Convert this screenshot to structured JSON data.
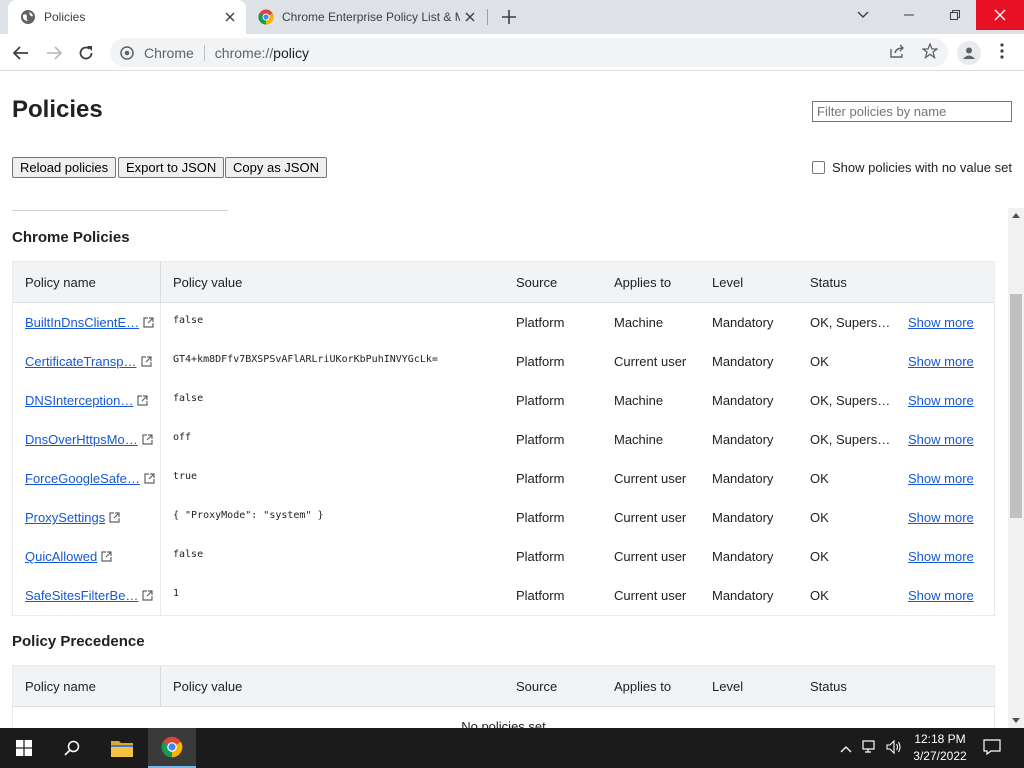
{
  "browser": {
    "tabs": [
      {
        "title": "Policies",
        "icon": "globe-icon",
        "active": true
      },
      {
        "title": "Chrome Enterprise Policy List & M",
        "icon": "chrome-logo-icon",
        "active": false
      }
    ],
    "omnibox": {
      "site_label": "Chrome",
      "url_scheme": "chrome://",
      "url_host": "policy"
    }
  },
  "page": {
    "title": "Policies",
    "filter_placeholder": "Filter policies by name",
    "buttons": {
      "reload": "Reload policies",
      "export": "Export to JSON",
      "copy": "Copy as JSON"
    },
    "show_no_value_label": "Show policies with no value set"
  },
  "chrome_policies": {
    "title": "Chrome Policies",
    "headers": {
      "name": "Policy name",
      "value": "Policy value",
      "source": "Source",
      "applies": "Applies to",
      "level": "Level",
      "status": "Status"
    },
    "rows": [
      {
        "name": "BuiltInDnsClientE…",
        "value": "false",
        "source": "Platform",
        "applies": "Machine",
        "level": "Mandatory",
        "status": "OK, Supers…",
        "more": "Show more"
      },
      {
        "name": "CertificateTransp…",
        "value": "GT4+km8DFfv7BXSPSvAFlARLriUKorKbPuhINVYGcLk=",
        "source": "Platform",
        "applies": "Current user",
        "level": "Mandatory",
        "status": "OK",
        "more": "Show more"
      },
      {
        "name": "DNSInterception…",
        "value": "false",
        "source": "Platform",
        "applies": "Machine",
        "level": "Mandatory",
        "status": "OK, Supers…",
        "more": "Show more"
      },
      {
        "name": "DnsOverHttpsMo…",
        "value": "off",
        "source": "Platform",
        "applies": "Machine",
        "level": "Mandatory",
        "status": "OK, Supers…",
        "more": "Show more"
      },
      {
        "name": "ForceGoogleSafe…",
        "value": "true",
        "source": "Platform",
        "applies": "Current user",
        "level": "Mandatory",
        "status": "OK",
        "more": "Show more"
      },
      {
        "name": "ProxySettings",
        "value": "{ \"ProxyMode\": \"system\" }",
        "source": "Platform",
        "applies": "Current user",
        "level": "Mandatory",
        "status": "OK",
        "more": "Show more"
      },
      {
        "name": "QuicAllowed",
        "value": "false",
        "source": "Platform",
        "applies": "Current user",
        "level": "Mandatory",
        "status": "OK",
        "more": "Show more"
      },
      {
        "name": "SafeSitesFilterBe…",
        "value": "1",
        "source": "Platform",
        "applies": "Current user",
        "level": "Mandatory",
        "status": "OK",
        "more": "Show more"
      }
    ]
  },
  "precedence": {
    "title": "Policy Precedence",
    "headers": {
      "name": "Policy name",
      "value": "Policy value",
      "source": "Source",
      "applies": "Applies to",
      "level": "Level",
      "status": "Status"
    },
    "empty_text": "No policies set"
  },
  "taskbar": {
    "time": "12:18 PM",
    "date": "3/27/2022"
  },
  "colors": {
    "link": "#1558d6",
    "tabstrip": "#dee1e6",
    "close_red": "#e81123",
    "taskbar": "#1b1b1b"
  }
}
